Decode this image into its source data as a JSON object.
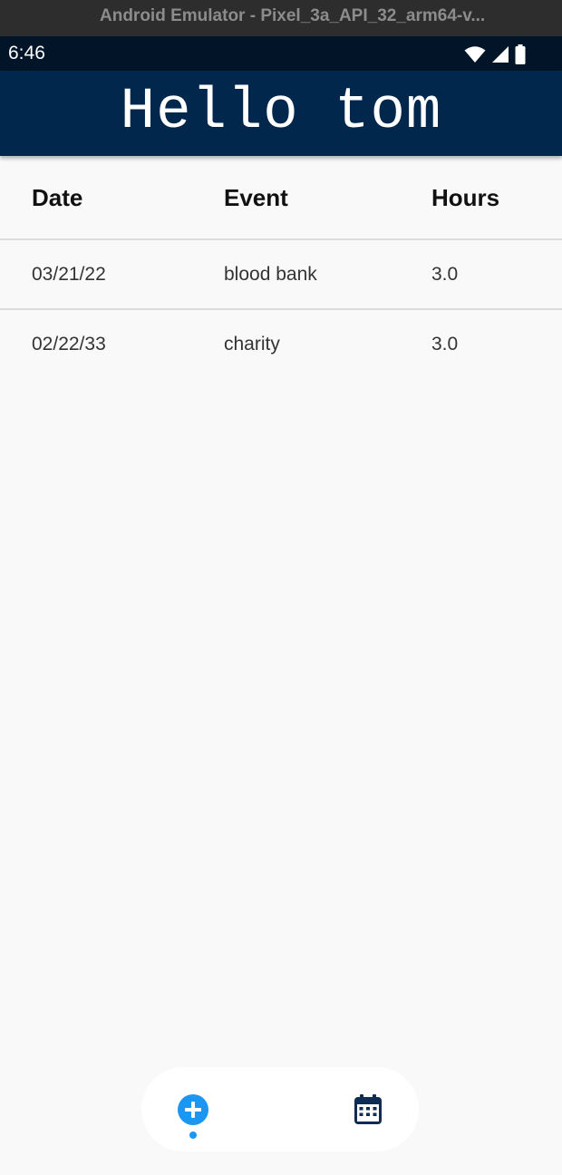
{
  "emulator": {
    "title": "Android Emulator - Pixel_3a_API_32_arm64-v..."
  },
  "status_bar": {
    "time": "6:46",
    "icons": [
      "wifi-icon",
      "cellular-signal-icon",
      "battery-icon"
    ]
  },
  "app_bar": {
    "title": "Hello tom"
  },
  "table": {
    "headers": [
      "Date",
      "Event",
      "Hours"
    ],
    "rows": [
      {
        "date": "03/21/22",
        "event": "blood bank",
        "hours": "3.0"
      },
      {
        "date": "02/22/33",
        "event": "charity",
        "hours": "3.0"
      }
    ]
  },
  "bottom_nav": {
    "items": [
      {
        "icon": "add-circle-icon",
        "active": true
      },
      {
        "icon": "calendar-icon",
        "active": false
      }
    ]
  },
  "colors": {
    "app_bar": "#01274c",
    "status_bar": "#011428",
    "accent": "#1b96f2",
    "calendar_icon": "#0f2c52",
    "background": "#f9f9f9"
  }
}
